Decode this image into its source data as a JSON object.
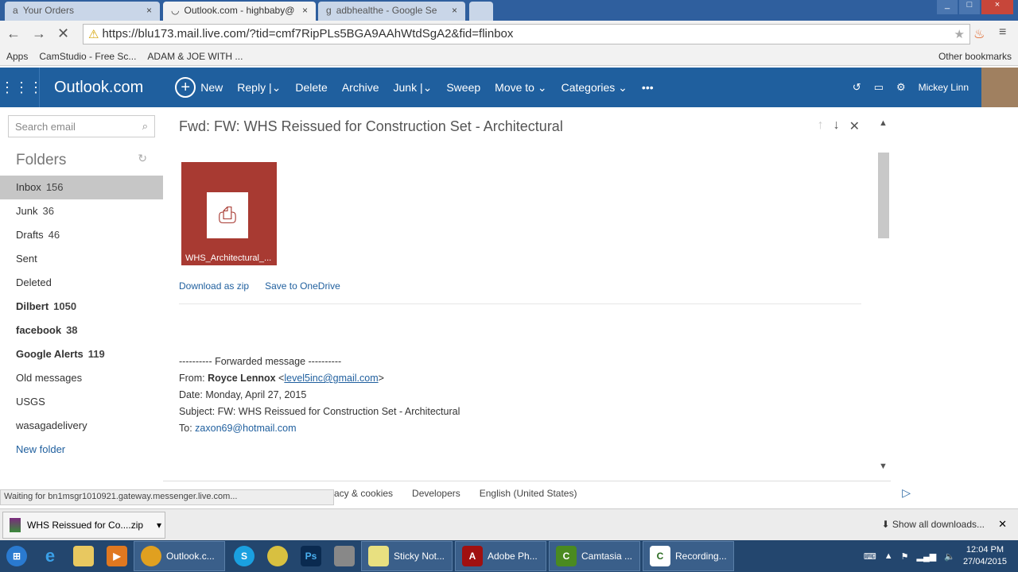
{
  "browser": {
    "tabs": [
      {
        "label": "Your Orders",
        "active": false
      },
      {
        "label": "Outlook.com - highbaby@",
        "active": true
      },
      {
        "label": "adbhealthe - Google Se",
        "active": false
      }
    ],
    "url": "https://blu173.mail.live.com/?tid=cmf7RipPLs5BGA9AAhWtdSgA2&fid=flinbox",
    "bookmarks": [
      "Apps",
      "CamStudio - Free Sc...",
      "ADAM & JOE WITH ..."
    ],
    "other_bookmarks": "Other bookmarks",
    "status": "Waiting for bn1msgr1010921.gateway.messenger.live.com..."
  },
  "outlook": {
    "brand": "Outlook.com",
    "commands": {
      "new": "New",
      "reply": "Reply",
      "delete": "Delete",
      "archive": "Archive",
      "junk": "Junk",
      "sweep": "Sweep",
      "move_to": "Move to",
      "categories": "Categories",
      "more": "•••"
    },
    "user": "Mickey Linn",
    "search_placeholder": "Search email",
    "folders_title": "Folders",
    "folders": [
      {
        "name": "Inbox",
        "count": "156"
      },
      {
        "name": "Junk",
        "count": "36"
      },
      {
        "name": "Drafts",
        "count": "46"
      },
      {
        "name": "Sent",
        "count": ""
      },
      {
        "name": "Deleted",
        "count": ""
      },
      {
        "name": "Dilbert",
        "count": "1050"
      },
      {
        "name": "facebook",
        "count": "38"
      },
      {
        "name": "Google Alerts",
        "count": "119"
      },
      {
        "name": "Old messages",
        "count": ""
      },
      {
        "name": "USGS",
        "count": ""
      },
      {
        "name": "wasagadelivery",
        "count": ""
      }
    ],
    "new_folder": "New folder",
    "message": {
      "subject": "Fwd: FW: WHS Reissued for Construction Set - Architectural",
      "attachment": "WHS_Architectural_...",
      "download_zip": "Download as zip",
      "save_onedrive": "Save to OneDrive",
      "forwarded": "---------- Forwarded message ----------",
      "from_label": "From:",
      "from_name": "Royce Lennox",
      "from_email": "level5inc@gmail.com",
      "date": "Date: Monday, April 27, 2015",
      "subject_line": "Subject: FW: WHS Reissued for Construction Set - Architectural",
      "to_label": "To:",
      "to_email": "zaxon69@hotmail.com"
    },
    "footer": [
      "acy & cookies",
      "Developers",
      "English (United States)"
    ]
  },
  "downloads": {
    "item": "WHS Reissued for Co....zip",
    "show_all": "Show all downloads..."
  },
  "taskbar": {
    "items": [
      "Outlook.c...",
      "Sticky Not...",
      "Adobe Ph...",
      "Camtasia ...",
      "Recording..."
    ],
    "time": "12:04 PM",
    "date": "27/04/2015"
  },
  "colors": {
    "brand": "#1f5f9e",
    "attachment": "#a83a32"
  }
}
